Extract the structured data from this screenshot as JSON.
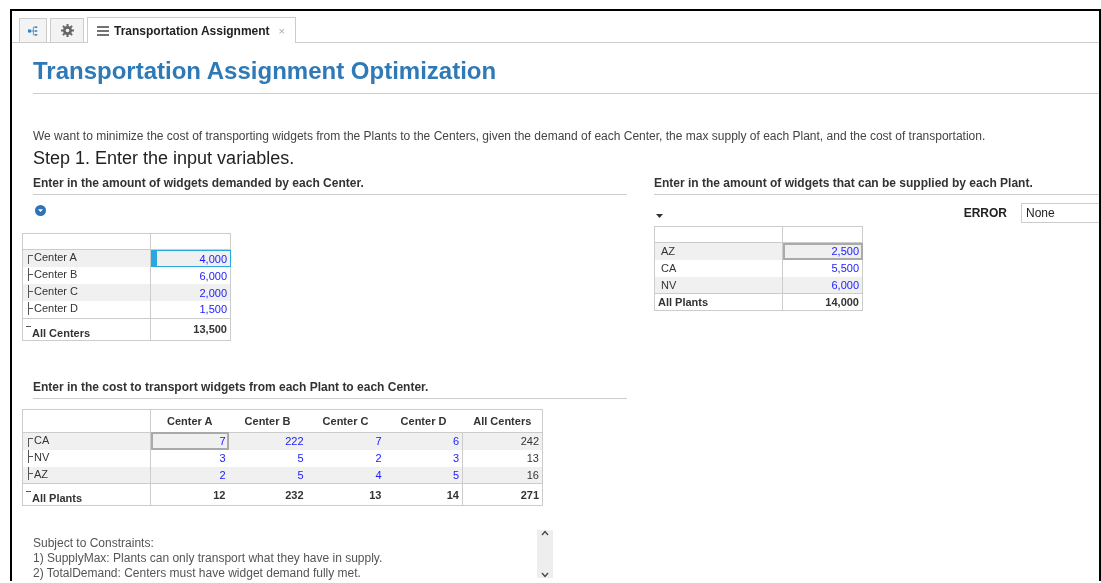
{
  "tabs": [
    {
      "kind": "tree",
      "selected": false
    },
    {
      "kind": "gear",
      "selected": false
    },
    {
      "kind": "doc",
      "label": "Transportation Assignment",
      "close": "×",
      "selected": true
    }
  ],
  "title": "Transportation Assignment Optimization",
  "description": "We want to minimize the cost of transporting widgets from the Plants to the Centers, given the demand of each Center, the max supply of each Plant, and the cost of transportation.",
  "step": "Step 1. Enter the input variables.",
  "demand": {
    "heading": "Enter in the amount of widgets demanded by each Center.",
    "rows": [
      {
        "label": "Center A",
        "values": [
          {
            "text": "4,000",
            "selected": true
          }
        ]
      },
      {
        "label": "Center B",
        "values": [
          {
            "text": "6,000",
            "selected": false
          }
        ]
      },
      {
        "label": "Center C",
        "values": [
          {
            "text": "2,000",
            "selected": false
          }
        ]
      },
      {
        "label": "Center D",
        "values": [
          {
            "text": "1,500",
            "selected": false
          }
        ]
      }
    ],
    "total": {
      "label": "All Centers",
      "values": [
        "13,500"
      ]
    }
  },
  "supply": {
    "heading": "Enter in the amount of widgets that can be supplied by each Plant.",
    "error_label": "ERROR",
    "error_value": "None",
    "rows": [
      {
        "label": "AZ",
        "values": [
          {
            "text": "2,500",
            "selected": true
          }
        ]
      },
      {
        "label": "CA",
        "values": [
          {
            "text": "5,500",
            "selected": false
          }
        ]
      },
      {
        "label": "NV",
        "values": [
          {
            "text": "6,000",
            "selected": false
          }
        ]
      }
    ],
    "total": {
      "label": "All Plants",
      "values": [
        "14,000"
      ]
    }
  },
  "cost": {
    "heading": "Enter in the cost to transport widgets from each Plant to each Center.",
    "columns": [
      "Center A",
      "Center B",
      "Center C",
      "Center D"
    ],
    "total_column": "All Centers",
    "rows": [
      {
        "label": "CA",
        "values": [
          {
            "text": "7",
            "selected": true
          },
          {
            "text": "222",
            "selected": false
          },
          {
            "text": "7",
            "selected": false
          },
          {
            "text": "6",
            "selected": false
          }
        ],
        "row_total": "242"
      },
      {
        "label": "NV",
        "values": [
          {
            "text": "3",
            "selected": false
          },
          {
            "text": "5",
            "selected": false
          },
          {
            "text": "2",
            "selected": false
          },
          {
            "text": "3",
            "selected": false
          }
        ],
        "row_total": "13"
      },
      {
        "label": "AZ",
        "values": [
          {
            "text": "2",
            "selected": false
          },
          {
            "text": "5",
            "selected": false
          },
          {
            "text": "4",
            "selected": false
          },
          {
            "text": "5",
            "selected": false
          }
        ],
        "row_total": "16"
      }
    ],
    "total": {
      "label": "All Plants",
      "values": [
        "12",
        "232",
        "13",
        "14"
      ],
      "row_total": "271"
    }
  },
  "constraints": [
    "Subject to Constraints:",
    "1) SupplyMax: Plants can only transport what they have in supply.",
    "2) TotalDemand: Centers must have widget demand fully met."
  ]
}
